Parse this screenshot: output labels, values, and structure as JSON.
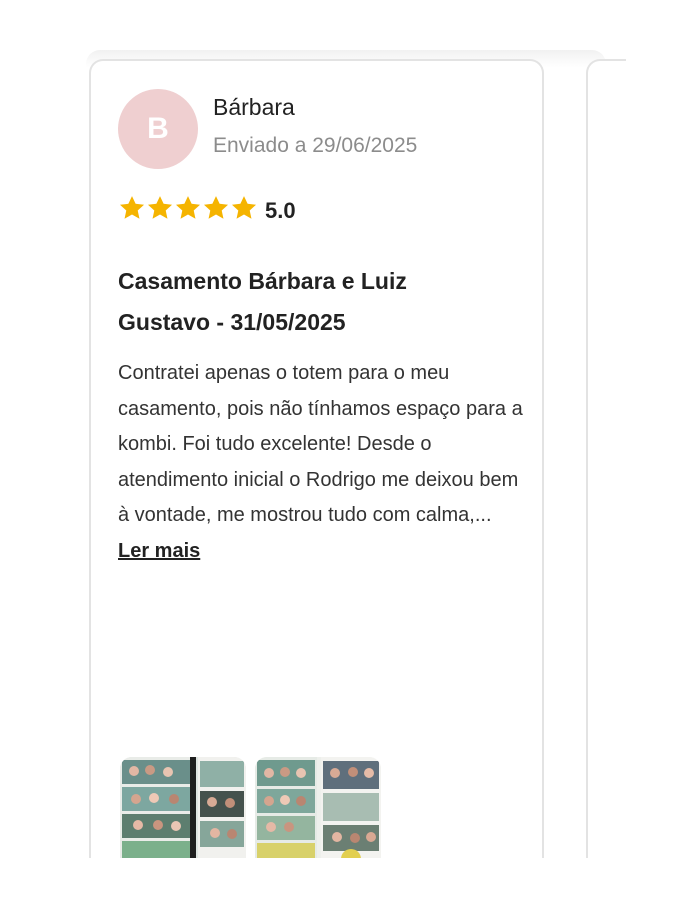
{
  "review": {
    "avatar_initial": "B",
    "reviewer_name": "Bárbara",
    "submitted_text": "Enviado a 29/06/2025",
    "rating": "5.0",
    "stars_filled": 5,
    "star_color": "#f5b400",
    "title_line1": "Casamento Bárbara e Luiz",
    "title_line2": "Gustavo - 31/05/2025",
    "body_text": "Contratei apenas o totem para o meu casamento, pois não tínhamos espaço para a kombi. Foi tudo excelente! Desde o atendimento inicial o Rodrigo me deixou bem à vontade, me mostrou tudo com calma,... ",
    "read_more_label": "Ler mais"
  },
  "colors": {
    "avatar_bg": "#efcfd0",
    "text_primary": "#222222",
    "text_secondary": "#8c8c8c",
    "card_border": "#e3e3e3"
  }
}
